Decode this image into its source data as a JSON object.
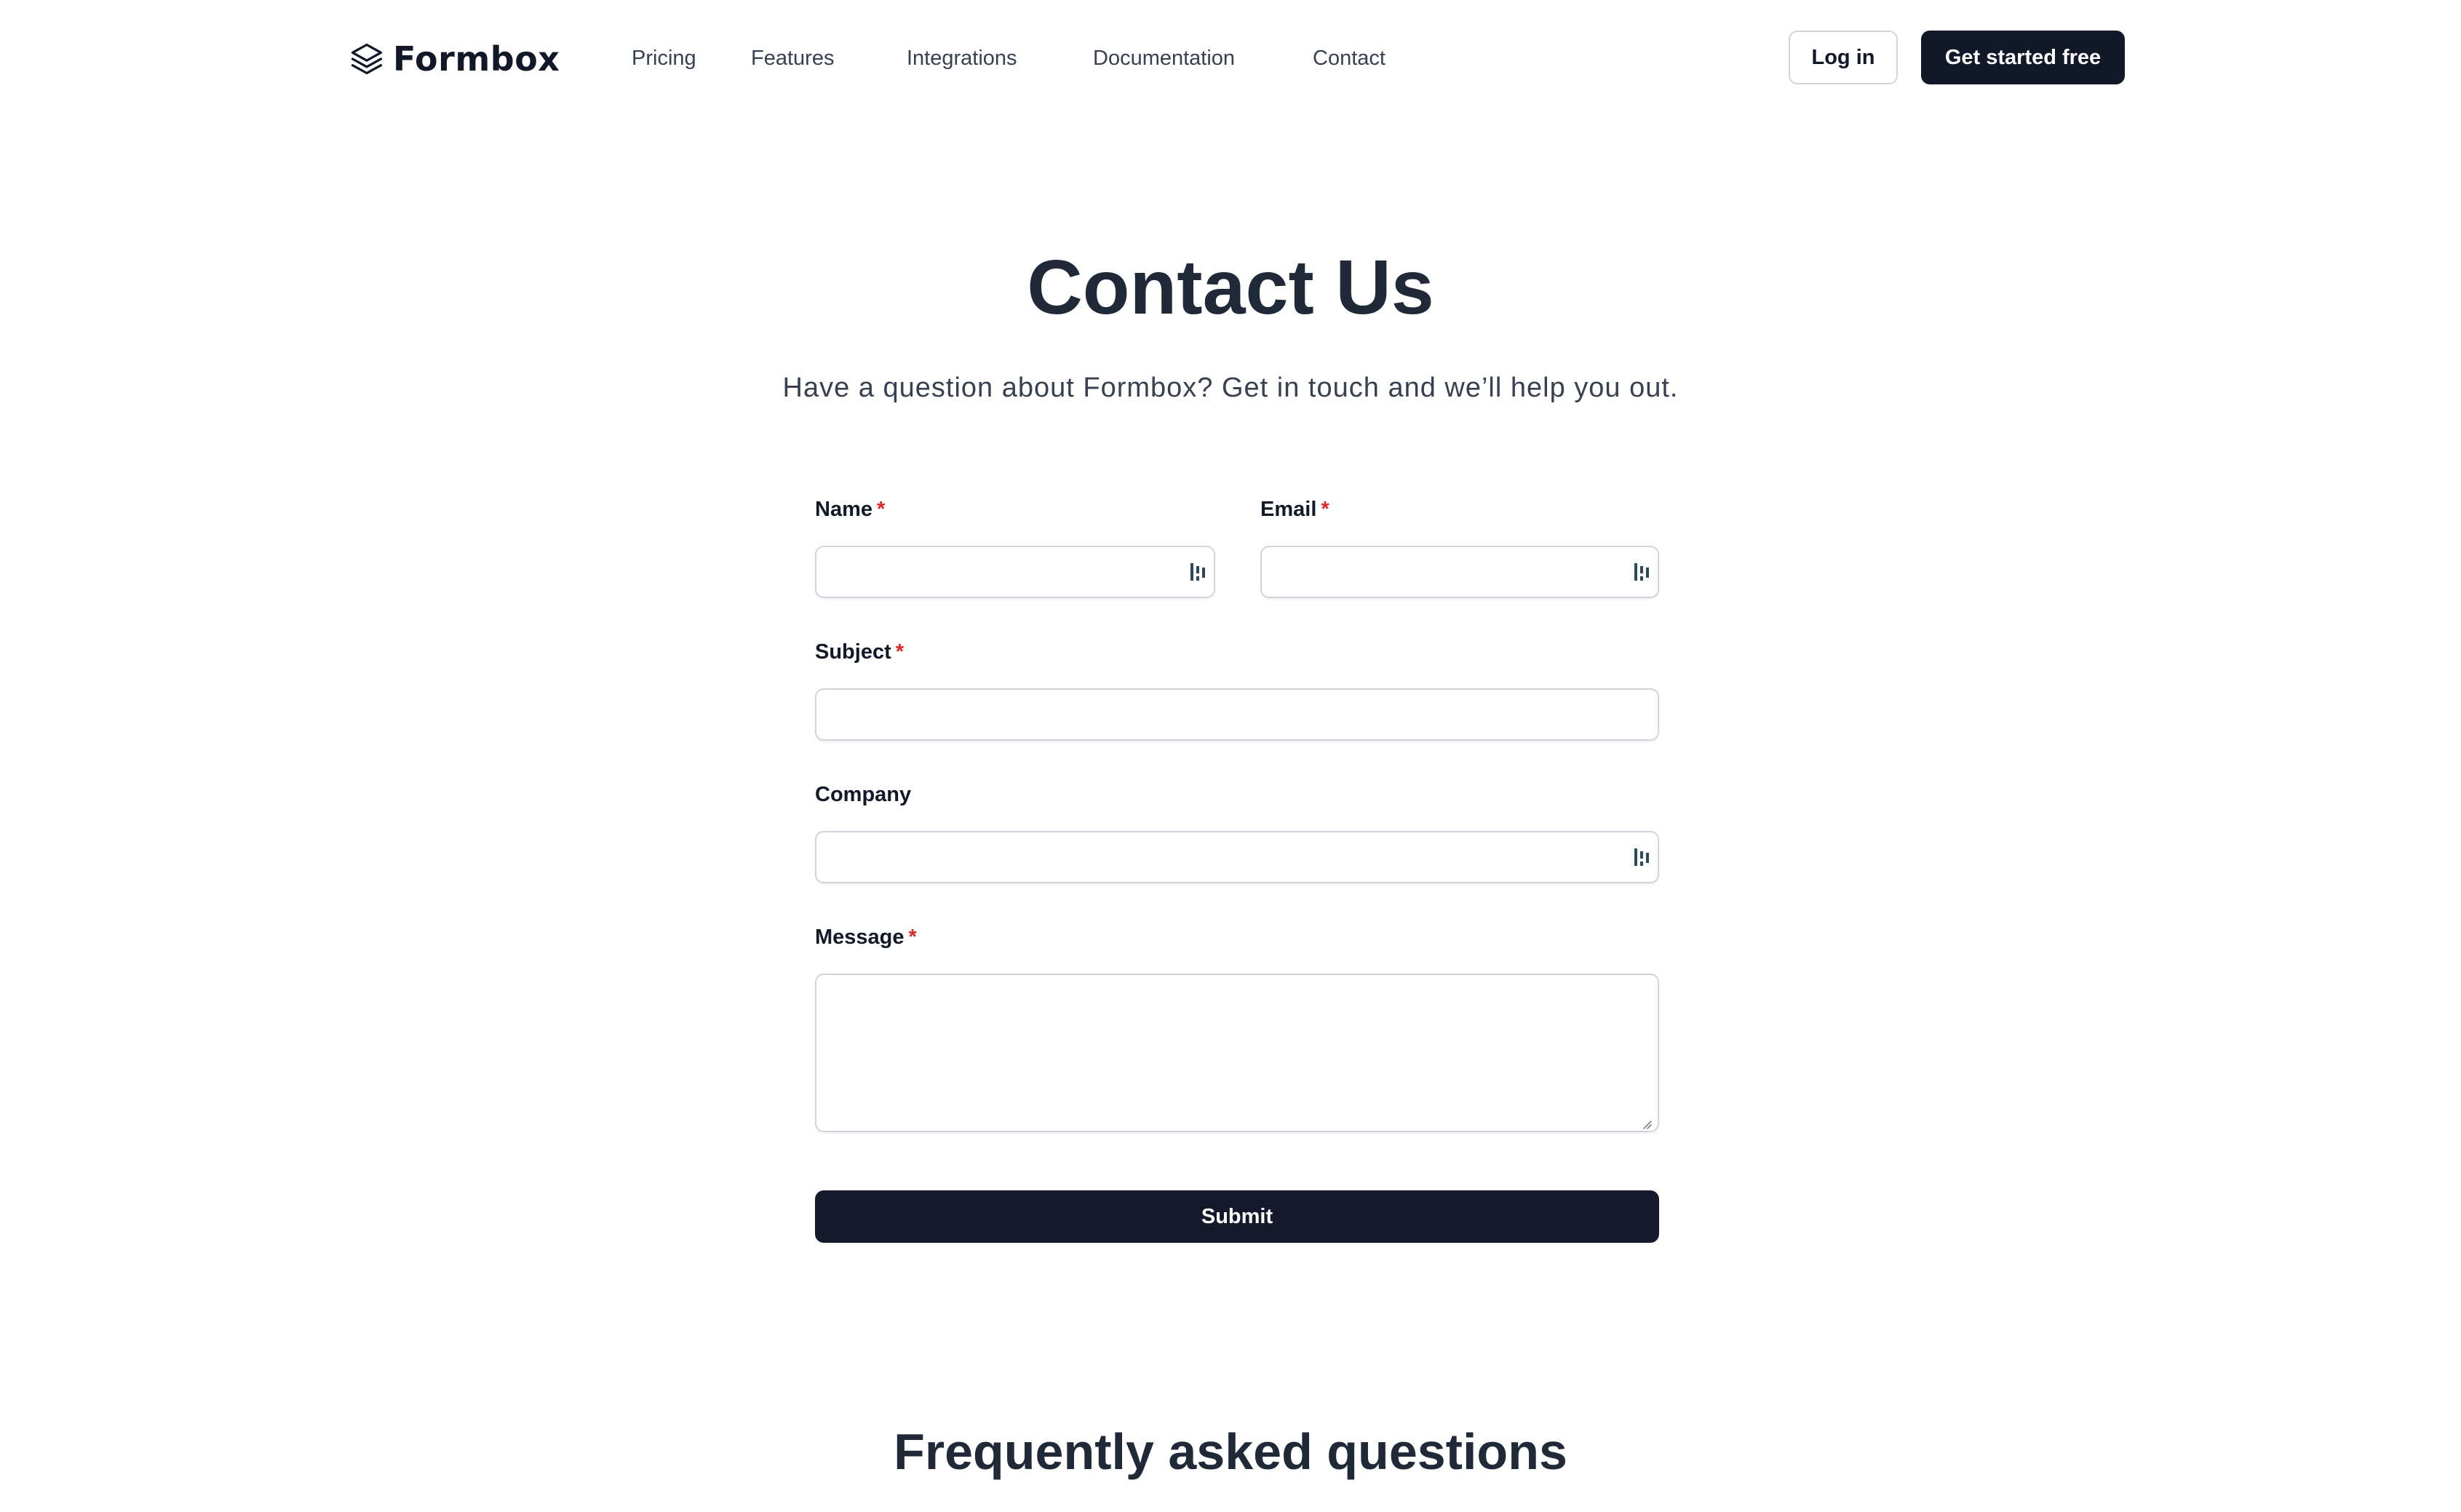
{
  "brand": {
    "name": "Formbox",
    "logo_icon": "stacked-layers-icon"
  },
  "nav": {
    "items": [
      {
        "label": "Pricing"
      },
      {
        "label": "Features"
      },
      {
        "label": "Integrations"
      },
      {
        "label": "Documentation"
      },
      {
        "label": "Contact"
      }
    ]
  },
  "header_actions": {
    "login_label": "Log in",
    "cta_label": "Get started free"
  },
  "hero": {
    "title": "Contact Us",
    "subtitle": "Have a question about Formbox? Get in touch and we’ll help you out."
  },
  "form": {
    "required_marker": "*",
    "name": {
      "label": "Name",
      "value": "",
      "placeholder": ""
    },
    "email": {
      "label": "Email",
      "value": "",
      "placeholder": ""
    },
    "subject": {
      "label": "Subject",
      "value": "",
      "placeholder": ""
    },
    "company": {
      "label": "Company",
      "value": "",
      "placeholder": ""
    },
    "message": {
      "label": "Message",
      "value": "",
      "placeholder": ""
    },
    "submit_label": "Submit",
    "autofill_icon": "password-manager-icon"
  },
  "faq": {
    "title": "Frequently asked questions"
  },
  "colors": {
    "primary": "#111827",
    "required": "#dc2626",
    "border": "#d1d5db",
    "autofill_icon": "#2d4a5c"
  }
}
